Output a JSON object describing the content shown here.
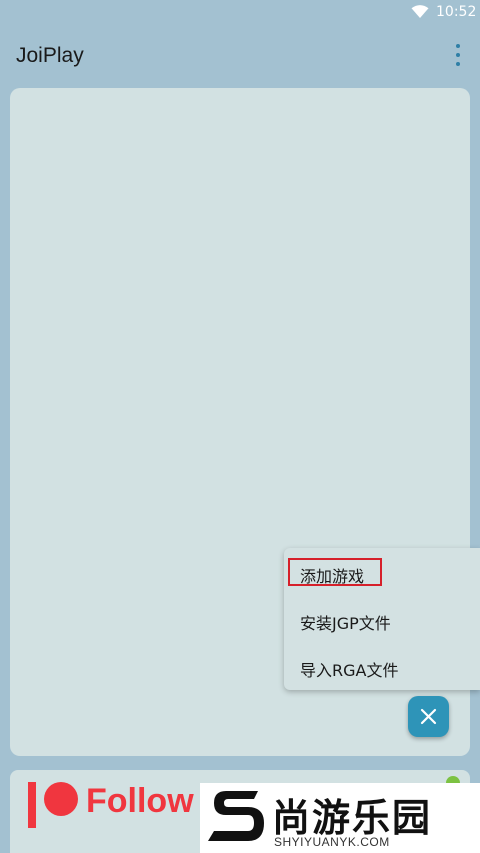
{
  "status_bar": {
    "time": "10:52",
    "wifi_icon": "wifi-icon"
  },
  "app_bar": {
    "title": "JoiPlay",
    "menu_icon": "more-vert-icon"
  },
  "fab_menu": {
    "items": [
      {
        "label": "添加游戏",
        "highlighted": true
      },
      {
        "label": "安装JGP文件"
      },
      {
        "label": "导入RGA文件"
      }
    ],
    "close_icon": "close-icon"
  },
  "banner": {
    "text": "Follow"
  },
  "watermark": {
    "cn_text": "尚游乐园",
    "en_text": "SHYIYUANYK.COM"
  },
  "colors": {
    "background": "#a3c1d1",
    "card": "#d2e1e2",
    "accent": "#2e94b8",
    "patreon": "#f0363f",
    "highlight": "#d6202a"
  }
}
